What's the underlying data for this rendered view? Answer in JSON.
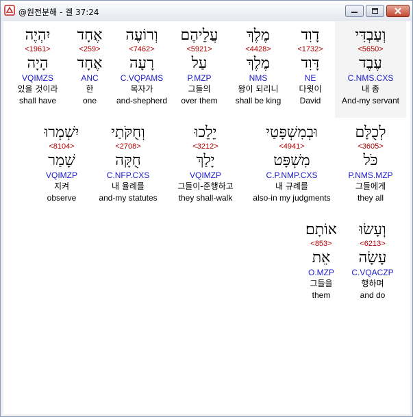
{
  "window": {
    "title": "@원전분해 - 겔 37:24"
  },
  "rows": [
    {
      "words": [
        {
          "heb": "וְעַבְדִּי",
          "strong": "<5650>",
          "lemma": "עֶבֶד",
          "gram": "C.NMS.CXS",
          "kor": "내 종",
          "eng": "And-my servant",
          "selected": true
        },
        {
          "heb": "דָוִד",
          "strong": "<1732>",
          "lemma": "דָּוִד",
          "gram": "NE",
          "kor": "다윗이",
          "eng": "David"
        },
        {
          "heb": "מֶלֶךְ",
          "strong": "<4428>",
          "lemma": "מֶלֶךְ",
          "gram": "NMS",
          "kor": "왕이 되리니",
          "eng": "shall be king"
        },
        {
          "heb": "עֲלֵיהֶם",
          "strong": "<5921>",
          "lemma": "עַל",
          "gram": "P.MZP",
          "kor": "그들의",
          "eng": "over them"
        },
        {
          "heb": "וְרוֹעֶה",
          "strong": "<7462>",
          "lemma": "רָעָה",
          "gram": "C.VQPAMS",
          "kor": "목자가",
          "eng": "and-shepherd"
        },
        {
          "heb": "אֶחָד",
          "strong": "<259>",
          "lemma": "אֶחָד",
          "gram": "ANC",
          "kor": "한",
          "eng": "one"
        },
        {
          "heb": "יִהְיֶה",
          "strong": "<1961>",
          "lemma": "הָיָה",
          "gram": "VQIMZS",
          "kor": "있을 것이라",
          "eng": "shall have"
        }
      ]
    },
    {
      "words": [
        {
          "heb": "לְכֻלָּם",
          "strong": "<3605>",
          "lemma": "כֹּל",
          "gram": "P.NMS.MZP",
          "kor": "그들에게",
          "eng": "they all"
        },
        {
          "heb": "וּבְמִשְׁפָּטַי",
          "strong": "<4941>",
          "lemma": "מִשְׁפָּט",
          "gram": "C.P.NMP.CXS",
          "kor": "내 규례를",
          "eng": "also-in my judgments"
        },
        {
          "heb": "יֵלֵכוּ",
          "strong": "<3212>",
          "lemma": "יָלַךְ",
          "gram": "VQIMZP",
          "kor": "그들이-준행하고",
          "eng": "they shall-walk"
        },
        {
          "heb": "וְחֻקֹּתַי",
          "strong": "<2708>",
          "lemma": "חֻקָּה",
          "gram": "C.NFP.CXS",
          "kor": "내 율례를",
          "eng": "and-my statutes"
        },
        {
          "heb": "יִשְׁמְרוּ",
          "strong": "<8104>",
          "lemma": "שָׁמַר",
          "gram": "VQIMZP",
          "kor": "지켜",
          "eng": "observe"
        }
      ]
    },
    {
      "words": [
        {
          "heb": "וְעָשׂוּ",
          "strong": "<6213>",
          "lemma": "עָשָׂה",
          "gram": "C.VQACZP",
          "kor": "행하며",
          "eng": "and do"
        },
        {
          "heb": "אוֹתָם׃",
          "strong": "<853>",
          "lemma": "אֵת",
          "gram": "O.MZP",
          "kor": "그들을",
          "eng": "them"
        }
      ]
    }
  ]
}
